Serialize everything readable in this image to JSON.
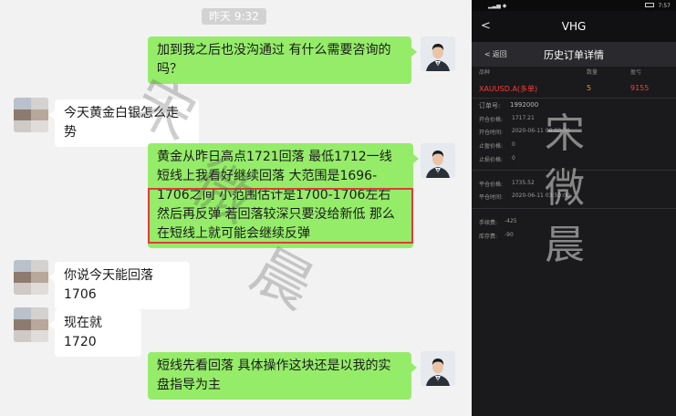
{
  "chat": {
    "timestamp": "昨天 9:32",
    "messages": [
      {
        "from": "me",
        "text": "加到我之后也没沟通过 有什么需要咨询的吗？"
      },
      {
        "from": "them",
        "text": "今天黄金白银怎么走势"
      },
      {
        "from": "me",
        "text": "黄金从昨日高点1721回落 最低1712一线 短线上我看好继续回落 大范围是1696-1706之间 小范围估计是1700-1706左右 然后再反弹 若回落较深只要没给新低 那么在短线上就可能会继续反弹"
      },
      {
        "from": "them",
        "text": "你说今天能回落1706"
      },
      {
        "from": "them",
        "text": "现在就1720"
      },
      {
        "from": "me",
        "text": "短线先看回落 具体操作这块还是以我的实盘指导为主"
      }
    ],
    "watermark": "宋微晨",
    "highlight_color": "#e4393c"
  },
  "phone": {
    "status_time": "7:57",
    "app_title": "VHG",
    "return_label": "返回",
    "page_title": "历史订单详情",
    "table_headers": [
      "品种",
      "数量",
      "盈亏"
    ],
    "order": {
      "symbol": "XAUUSD.A",
      "direction": "(多单)",
      "lots": "5",
      "profit": "9155"
    },
    "fields": [
      {
        "label": "订单号:",
        "value": "1992000"
      },
      {
        "label": "开仓价格:",
        "value": "1717.21"
      },
      {
        "label": "开仓时间:",
        "value": "2020-06-11 00:00:00"
      },
      {
        "label": "止盈价格:",
        "value": "0"
      },
      {
        "label": "止损价格:",
        "value": "0"
      },
      {
        "label": "平仓价格:",
        "value": "1735.52"
      },
      {
        "label": "平仓时间:",
        "value": "2020-06-11 03:50:00"
      },
      {
        "label": "手续费:",
        "value": "-425"
      },
      {
        "label": "库存费:",
        "value": "-90"
      }
    ],
    "watermark_chars": [
      "宋",
      "微",
      "晨"
    ],
    "colors": {
      "symbol": "#ff3b30",
      "profit": "#ff3b30"
    }
  }
}
